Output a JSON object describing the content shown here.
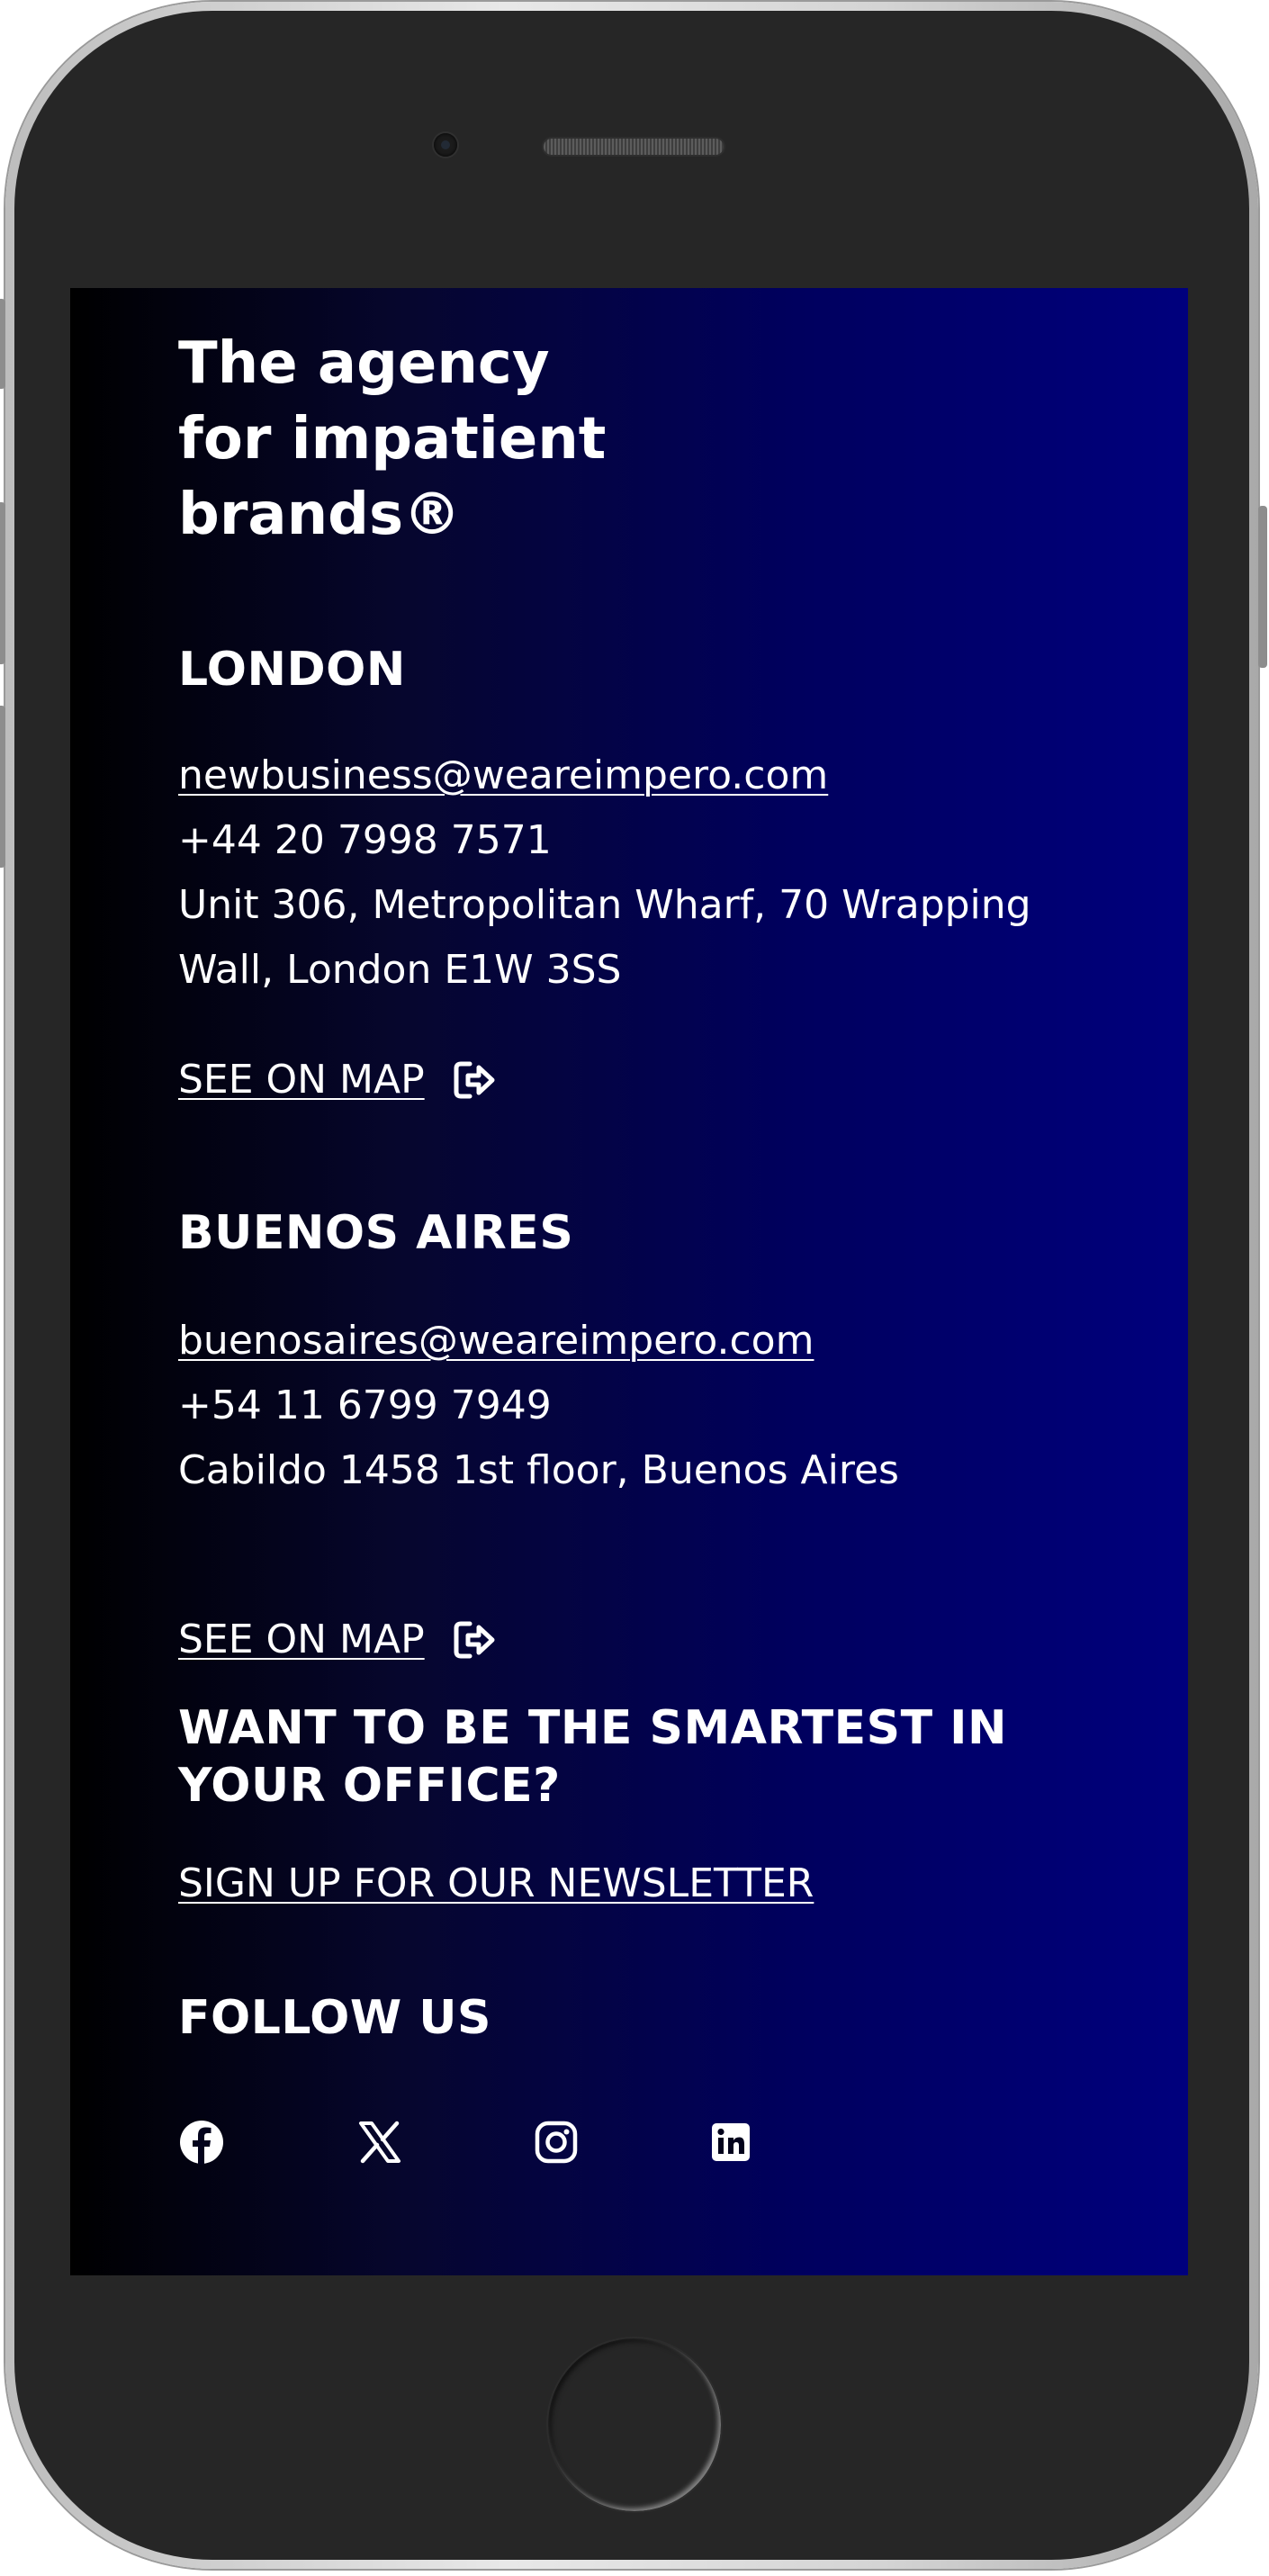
{
  "footer": {
    "tagline": [
      "The agency",
      "for impatient",
      "brands®"
    ],
    "london": {
      "heading": "LONDON",
      "email": "newbusiness@weareimpero.com",
      "phone": "+44 20 7998 7571",
      "address_line1": "Unit 306, Metropolitan Wharf, 70 Wrapping",
      "address_line2": "Wall, London E1W 3SS",
      "map_label": "SEE ON MAP",
      "map_icon": "external-link-icon"
    },
    "buenos_aires": {
      "heading": "BUENOS AIRES",
      "email": "buenosaires@weareimpero.com",
      "phone": "+54 11 6799 7949",
      "address": "Cabildo 1458 1st floor, Buenos Aires",
      "map_label": "SEE ON MAP",
      "map_icon": "external-link-icon"
    },
    "newsletter": {
      "heading_line1": "WANT TO BE THE SMARTEST IN",
      "heading_line2": "YOUR OFFICE?",
      "link": "SIGN UP FOR OUR NEWSLETTER"
    },
    "follow": {
      "heading": "FOLLOW US",
      "icons": [
        "facebook-icon",
        "x-icon",
        "instagram-icon",
        "linkedin-icon"
      ]
    }
  },
  "colors": {
    "gradient_start": "#000000",
    "gradient_end": "#00007d",
    "text": "#ffffff",
    "device_body": "#262626"
  }
}
